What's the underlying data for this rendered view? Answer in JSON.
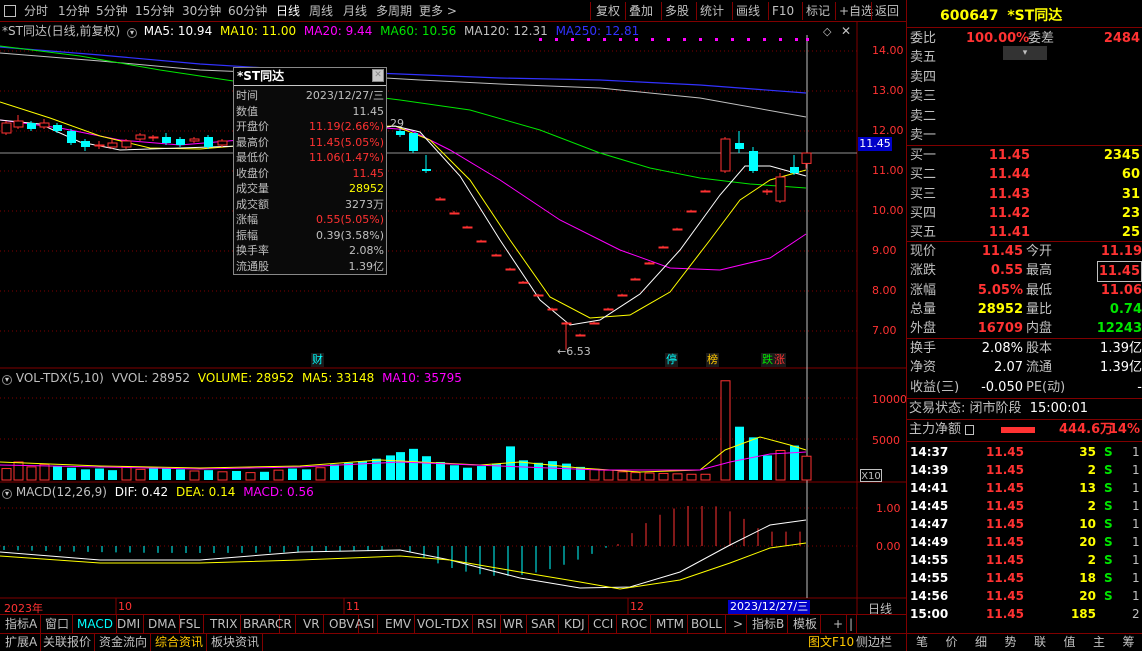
{
  "toolbar": {
    "left_items": [
      "分时",
      "1分钟",
      "5分钟",
      "15分钟",
      "30分钟",
      "60分钟",
      "日线",
      "周线",
      "月线",
      "多周期",
      "更多 >"
    ],
    "active": "日线",
    "right_items": [
      "复权",
      "叠加",
      "多股",
      "统计",
      "画线",
      "F10",
      "标记",
      "+自选",
      "返回"
    ]
  },
  "main_legend": {
    "title": "*ST同达(日线,前复权)",
    "ma5": "MA5: 10.94",
    "ma10": "MA10: 11.00",
    "ma20": "MA20: 9.44",
    "ma60": "MA60: 10.56",
    "ma120": "MA120: 12.31",
    "ma250": "MA250: 12.81"
  },
  "colors": {
    "ma5": "#ffffff",
    "ma10": "#ffff00",
    "ma20": "#ff00ff",
    "ma60": "#00e600",
    "ma120": "#c0c0c0",
    "ma250": "#3232ff",
    "up": "#ff3232",
    "down": "#00ffff",
    "grid": "#800000"
  },
  "price_axis": [
    "14.00",
    "13.00",
    "12.00",
    "11.00",
    "10.00",
    "9.00",
    "8.00",
    "7.00"
  ],
  "current_price_tag": "11.45",
  "low_marker": "6.53",
  "peak_marker": "29",
  "event_badges": [
    {
      "text": "财",
      "color": "#00ffff"
    },
    {
      "text": "停",
      "color": "#00ffff"
    },
    {
      "text": "榜",
      "color": "#ffc800"
    },
    {
      "text": "跌",
      "color": "#00e600"
    },
    {
      "text": "涨",
      "color": "#ff3232"
    }
  ],
  "tooltip": {
    "title": "*ST同达",
    "rows": [
      {
        "k": "时间",
        "v": "2023/12/27/三",
        "c": "#c0c0c0"
      },
      {
        "k": "数值",
        "v": "11.45",
        "c": "#c0c0c0"
      },
      {
        "k": "开盘价",
        "v": "11.19(2.66%)",
        "c": "#ff3232"
      },
      {
        "k": "最高价",
        "v": "11.45(5.05%)",
        "c": "#ff3232"
      },
      {
        "k": "最低价",
        "v": "11.06(1.47%)",
        "c": "#ff3232"
      },
      {
        "k": "收盘价",
        "v": "11.45",
        "c": "#ff3232"
      },
      {
        "k": "成交量",
        "v": "28952",
        "c": "#ffff00"
      },
      {
        "k": "成交额",
        "v": "3273万",
        "c": "#c0c0c0"
      },
      {
        "k": "涨幅",
        "v": "0.55(5.05%)",
        "c": "#ff3232"
      },
      {
        "k": "振幅",
        "v": "0.39(3.58%)",
        "c": "#c0c0c0"
      },
      {
        "k": "换手率",
        "v": "2.08%",
        "c": "#c0c0c0"
      },
      {
        "k": "流通股",
        "v": "1.39亿",
        "c": "#c0c0c0"
      }
    ]
  },
  "volume_legend": {
    "title": "VOL-TDX(5,10)",
    "vvol": "VVOL: 28952",
    "volume": "VOLUME: 28952",
    "ma5": "MA5: 33148",
    "ma10": "MA10: 35795"
  },
  "volume_axis": [
    "10000",
    "5000"
  ],
  "volume_unit": "X10",
  "macd_legend": {
    "title": "MACD(12,26,9)",
    "dif": "DIF: 0.42",
    "dea": "DEA: 0.14",
    "macd": "MACD: 0.56"
  },
  "macd_axis": [
    "1.00",
    "0.00"
  ],
  "date_axis": {
    "labels": [
      "2023年",
      "10",
      "11",
      "12"
    ],
    "cursor": "2023/12/27/三",
    "period": "日线"
  },
  "indicator_tabs": [
    "指标A",
    "窗口",
    "MACD",
    "DMI",
    "DMA",
    "FSL",
    "TRIX",
    "BRAR",
    "CR",
    "VR",
    "OBV",
    "ASI",
    "EMV",
    "VOL-TDX",
    "RSI",
    "WR",
    "SAR",
    "KDJ",
    "CCI",
    "ROC",
    "MTM",
    "BOLL",
    ">",
    "指标B",
    "模板",
    "+",
    "|"
  ],
  "indicator_active": "MACD",
  "bottom_tabs": [
    "扩展A",
    "关联报价",
    "资金流向",
    "综合资讯",
    "板块资讯"
  ],
  "bottom_active": "综合资讯",
  "bottom_right": [
    "图文F10",
    "侧边栏"
  ],
  "right_panel": {
    "code": "600647",
    "name": "*ST同达",
    "weibi_label": "委比",
    "weibi": "100.00%",
    "weicha_label": "委差",
    "weicha": "2484",
    "sells": [
      "卖五",
      "卖四",
      "卖三",
      "卖二",
      "卖一"
    ],
    "buys": [
      {
        "label": "买一",
        "price": "11.45",
        "vol": "2345"
      },
      {
        "label": "买二",
        "price": "11.44",
        "vol": "60"
      },
      {
        "label": "买三",
        "price": "11.43",
        "vol": "31"
      },
      {
        "label": "买四",
        "price": "11.42",
        "vol": "23"
      },
      {
        "label": "买五",
        "price": "11.41",
        "vol": "25"
      }
    ],
    "stats": [
      {
        "k1": "现价",
        "v1": "11.45",
        "c1": "#ff3232",
        "k2": "今开",
        "v2": "11.19",
        "c2": "#ff3232"
      },
      {
        "k1": "涨跌",
        "v1": "0.55",
        "c1": "#ff3232",
        "k2": "最高",
        "v2": "11.45",
        "c2": "#ff3232"
      },
      {
        "k1": "涨幅",
        "v1": "5.05%",
        "c1": "#ff3232",
        "k2": "最低",
        "v2": "11.06",
        "c2": "#ff3232"
      },
      {
        "k1": "总量",
        "v1": "28952",
        "c1": "#ffff00",
        "k2": "量比",
        "v2": "0.74",
        "c2": "#00e600"
      },
      {
        "k1": "外盘",
        "v1": "16709",
        "c1": "#ff3232",
        "k2": "内盘",
        "v2": "12243",
        "c2": "#00e600"
      }
    ],
    "stats2": [
      {
        "k1": "换手",
        "v1": "2.08%",
        "k2": "股本",
        "v2": "1.39亿"
      },
      {
        "k1": "净资",
        "v1": "2.07",
        "k2": "流通",
        "v2": "1.39亿"
      },
      {
        "k1": "收益(三)",
        "v1": "-0.050",
        "k2": "PE(动)",
        "v2": "-"
      }
    ],
    "trade_status_label": "交易状态:",
    "trade_status": "闭市阶段",
    "trade_time": "15:00:01",
    "main_flow_label": "主力净额",
    "main_flow": "444.6万",
    "main_flow_pct": "14%",
    "ticks": [
      {
        "t": "14:37",
        "p": "11.45",
        "v": "35",
        "s": "S",
        "n": "1"
      },
      {
        "t": "14:39",
        "p": "11.45",
        "v": "2",
        "s": "S",
        "n": "1"
      },
      {
        "t": "14:41",
        "p": "11.45",
        "v": "13",
        "s": "S",
        "n": "1"
      },
      {
        "t": "14:45",
        "p": "11.45",
        "v": "2",
        "s": "S",
        "n": "1"
      },
      {
        "t": "14:47",
        "p": "11.45",
        "v": "10",
        "s": "S",
        "n": "1"
      },
      {
        "t": "14:49",
        "p": "11.45",
        "v": "20",
        "s": "S",
        "n": "1"
      },
      {
        "t": "14:55",
        "p": "11.45",
        "v": "2",
        "s": "S",
        "n": "1"
      },
      {
        "t": "14:55",
        "p": "11.45",
        "v": "18",
        "s": "S",
        "n": "1"
      },
      {
        "t": "14:56",
        "p": "11.45",
        "v": "20",
        "s": "S",
        "n": "1"
      },
      {
        "t": "15:00",
        "p": "11.45",
        "v": "185",
        "s": "",
        "n": "2"
      }
    ],
    "footer": [
      "笔",
      "价",
      "细",
      "势",
      "联",
      "值",
      "主",
      "筹"
    ]
  }
}
